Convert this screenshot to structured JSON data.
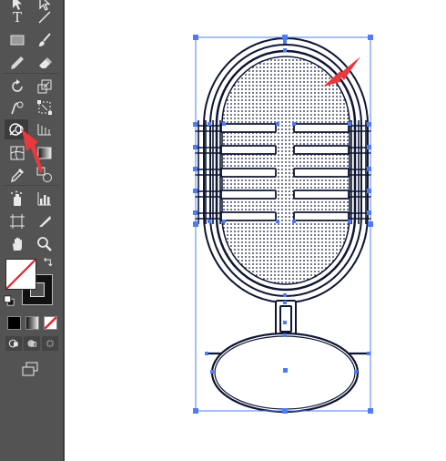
{
  "app": {
    "toolbar_tools": [
      "selection-tool",
      "direct-selection-tool",
      "type-tool",
      "line-segment-tool",
      "rectangle-tool",
      "paintbrush-tool",
      "pencil-tool",
      "eraser-tool",
      "rotate-tool",
      "scale-tool",
      "warp-tool",
      "free-transform-tool",
      "shape-builder-tool",
      "perspective-grid-tool",
      "mesh-tool",
      "gradient-tool",
      "eyedropper-tool",
      "blend-tool",
      "symbol-sprayer-tool",
      "column-graph-tool",
      "artboard-tool",
      "slice-tool",
      "hand-tool",
      "zoom-tool"
    ],
    "active_tool": "shape-builder-tool",
    "type_tool_glyph": "T",
    "colors": {
      "panel": "#535353",
      "selection": "#4d7cf6",
      "artwork_stroke": "#0f1633",
      "arrow": "#e8393c",
      "canvas": "#ffffff"
    },
    "fill_swatch": "none",
    "stroke_swatch": "#111111",
    "draw_modes": [
      "draw-normal",
      "draw-behind",
      "draw-inside"
    ],
    "screen_mode": "normal-screen-mode"
  }
}
